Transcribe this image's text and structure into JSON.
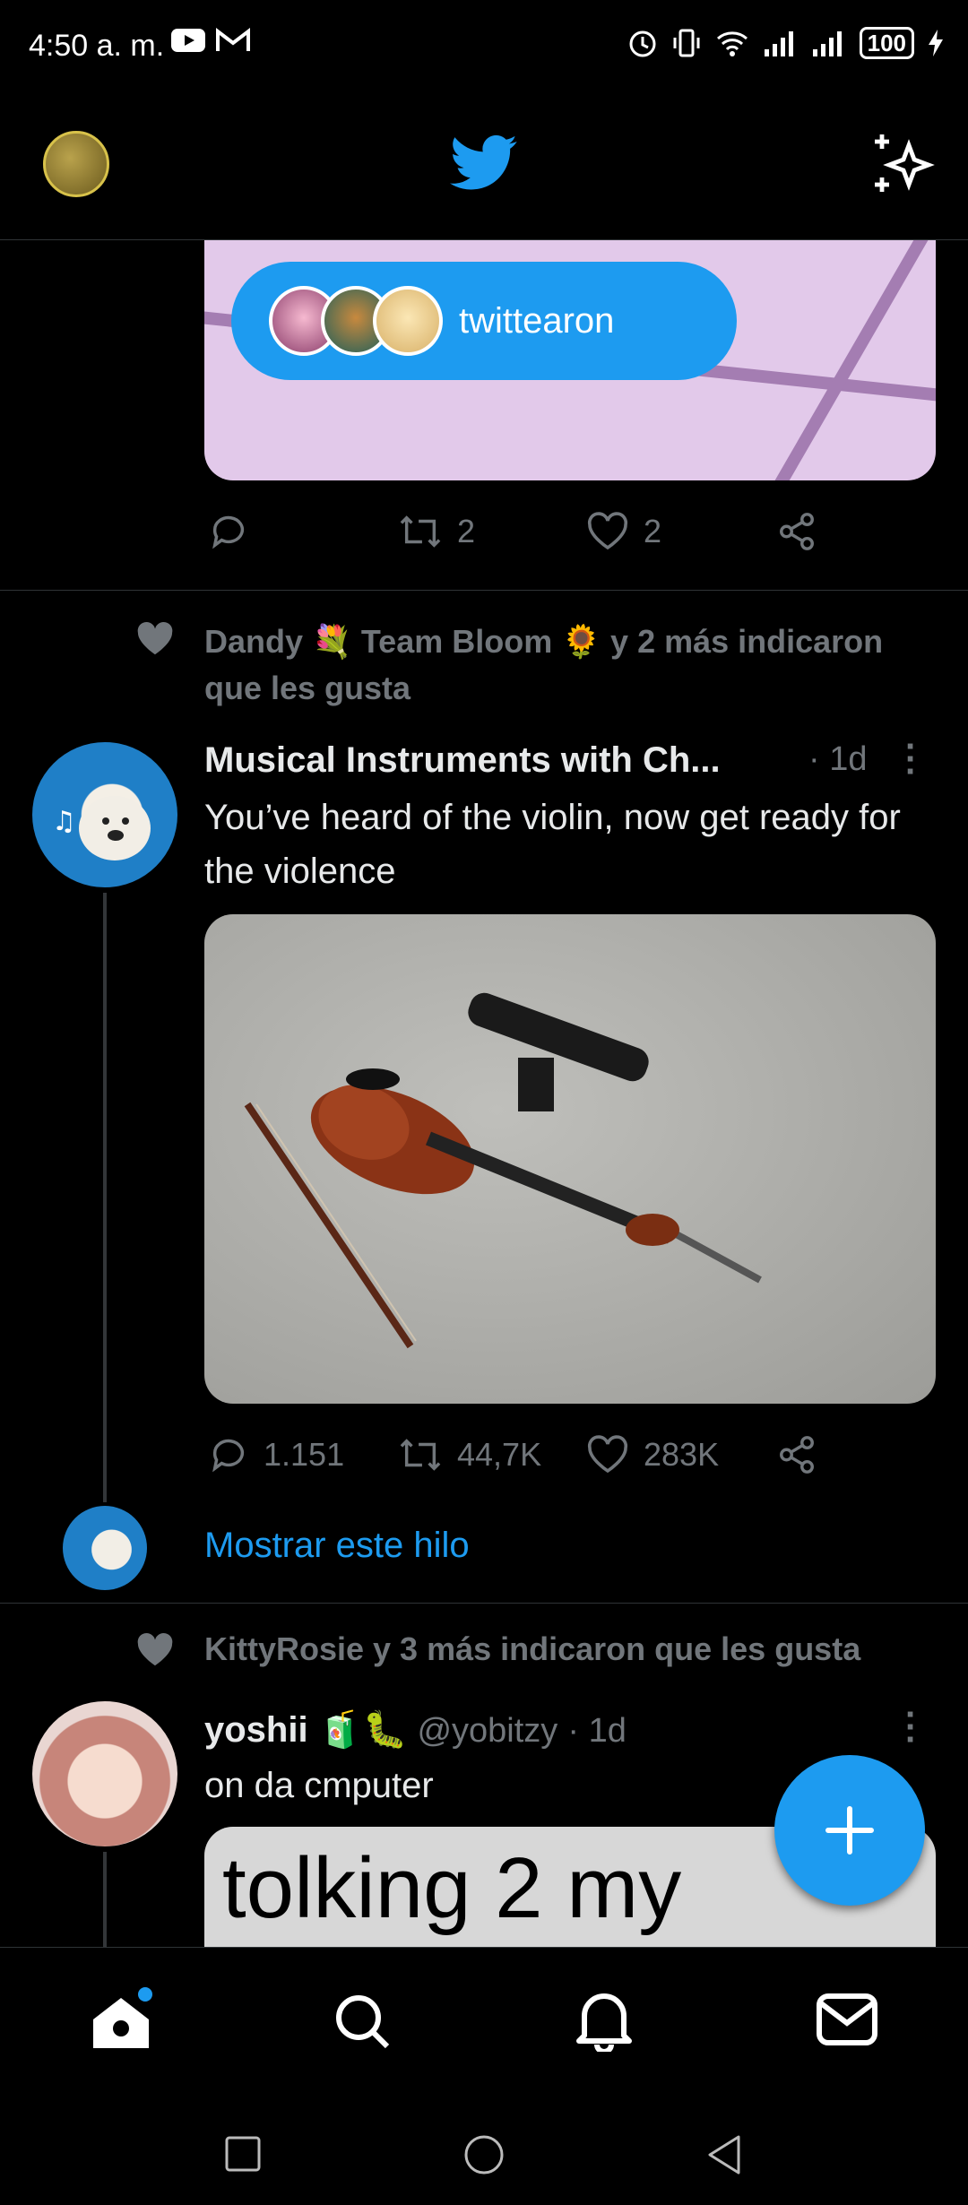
{
  "status_bar": {
    "time": "4:50 a. m.",
    "battery": "100"
  },
  "top_bar": {
    "logo_icon": "twitter-bird-icon",
    "sparkle_icon": "sparkle-icon"
  },
  "new_tweets_pill": {
    "label": "twittearon"
  },
  "tweet1": {
    "retweets": "2",
    "likes": "2"
  },
  "tweet2": {
    "social_context": "Dandy 💐 Team Bloom 🌻 y 2 más indicaron que les gusta",
    "author_name": "Musical Instruments with Ch...",
    "time": "· 1d",
    "text": "You’ve heard of the violin, now get ready for the violence",
    "replies": "1.151",
    "retweets": "44,7K",
    "likes": "283K",
    "show_thread": "Mostrar este hilo"
  },
  "tweet3": {
    "social_context": "KittyRosie y 3 más indicaron que les gusta",
    "author_name": "yoshii 🧃🐛",
    "handle": "@yobitzy",
    "time": "· 1d",
    "text": "on da cmputer",
    "image_text": "tolking 2 my"
  },
  "fab": {
    "label": "+"
  },
  "colors": {
    "accent": "#1d9bf0",
    "background": "#000000",
    "muted": "#71767b"
  }
}
